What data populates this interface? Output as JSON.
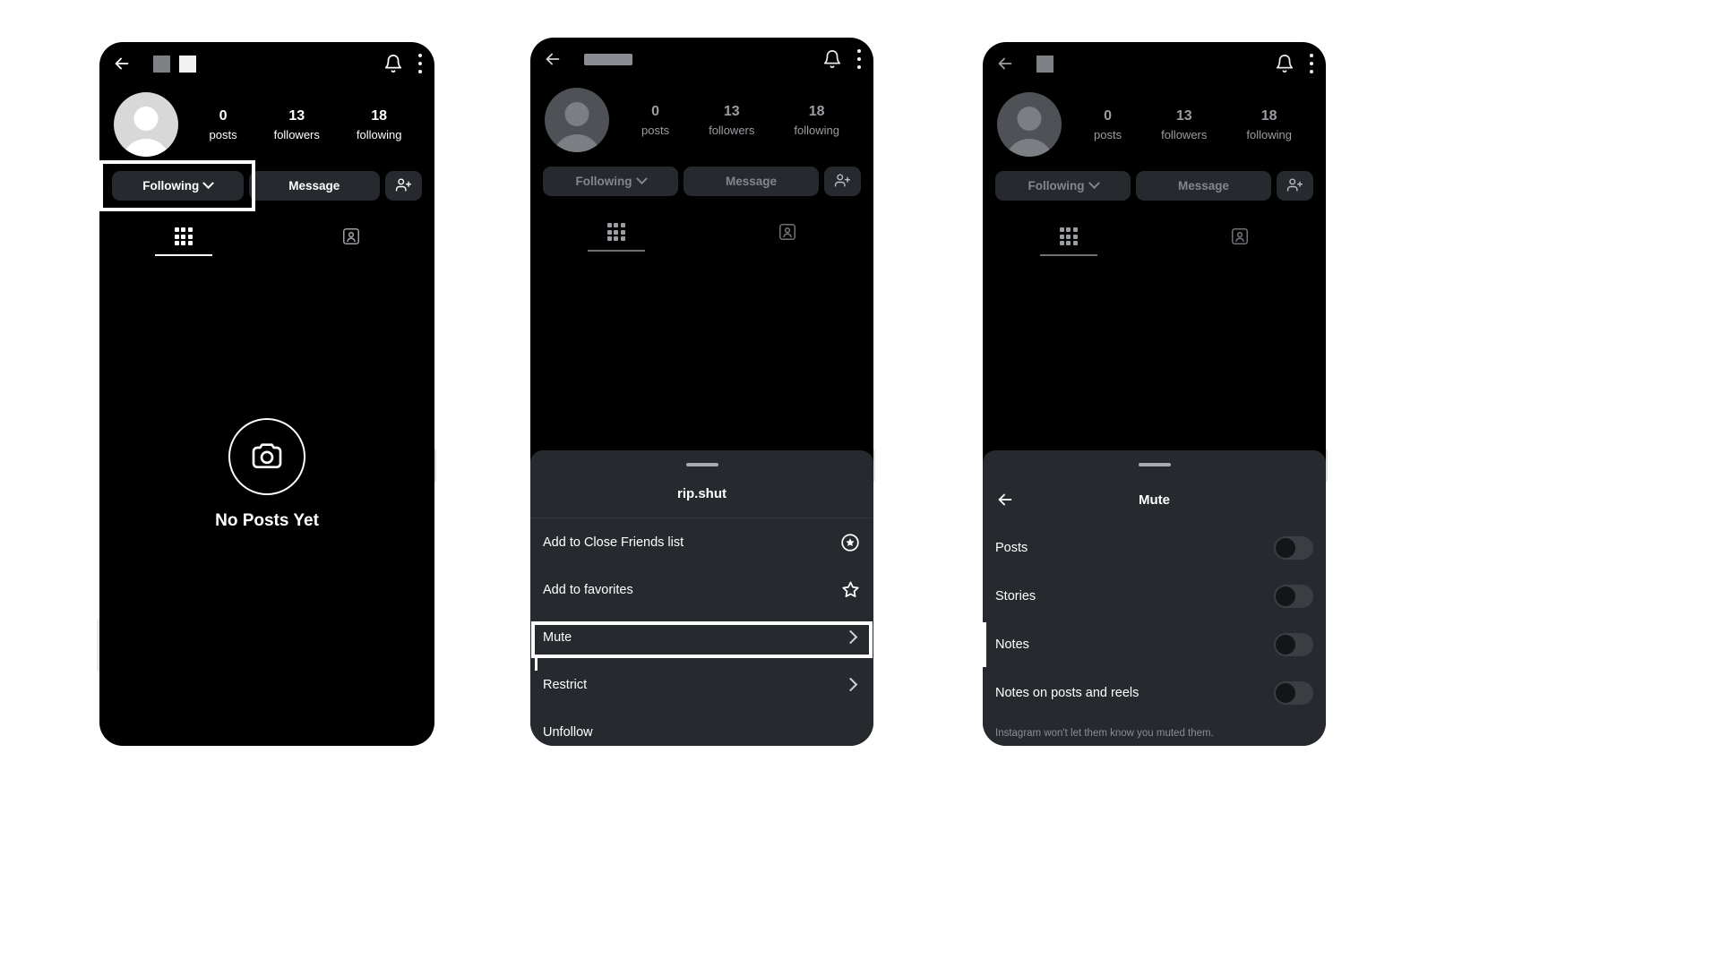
{
  "panels": [
    {
      "id": "profile",
      "topbar": {
        "back": "back-arrow",
        "bell": "notifications-bell",
        "menu": "overflow-menu",
        "username_redacted": true
      },
      "stats": [
        {
          "num": "0",
          "label": "posts"
        },
        {
          "num": "13",
          "label": "followers"
        },
        {
          "num": "18",
          "label": "following"
        }
      ],
      "actions": {
        "following": "Following",
        "message": "Message",
        "adduser": "add-user-icon"
      },
      "tabs": [
        {
          "icon": "grid-icon",
          "active": true
        },
        {
          "icon": "tagged-icon",
          "active": false
        }
      ],
      "empty_state": {
        "icon": "camera-icon",
        "label": "No Posts Yet"
      },
      "highlight": "Following"
    },
    {
      "id": "options-sheet",
      "topbar": {
        "back": "back-arrow",
        "bell": "notifications-bell",
        "menu": "overflow-menu"
      },
      "stats": [
        {
          "num": "0",
          "label": "posts"
        },
        {
          "num": "13",
          "label": "followers"
        },
        {
          "num": "18",
          "label": "following"
        }
      ],
      "actions": {
        "following": "Following",
        "message": "Message",
        "adduser": "add-user-icon"
      },
      "sheet_title": "rip.shut",
      "menu_items": [
        {
          "label": "Add to Close Friends list",
          "icon": "close-friends-star-circle-icon",
          "trailing": "icon"
        },
        {
          "label": "Add to favorites",
          "icon": "favorite-star-icon",
          "trailing": "icon"
        },
        {
          "label": "Mute",
          "icon": "chevron-right-icon",
          "trailing": "chevron",
          "highlighted": true
        },
        {
          "label": "Restrict",
          "icon": "chevron-right-icon",
          "trailing": "chevron"
        },
        {
          "label": "Unfollow",
          "icon": "",
          "trailing": "none"
        }
      ],
      "highlight": "Mute"
    },
    {
      "id": "mute-panel",
      "topbar": {
        "back": "back-arrow",
        "bell": "notifications-bell",
        "menu": "overflow-menu"
      },
      "stats": [
        {
          "num": "0",
          "label": "posts"
        },
        {
          "num": "13",
          "label": "followers"
        },
        {
          "num": "18",
          "label": "following"
        }
      ],
      "actions": {
        "following": "Following",
        "message": "Message",
        "adduser": "add-user-icon"
      },
      "sheet_title": "Mute",
      "back_label": "back-arrow",
      "toggles": [
        {
          "label": "Posts",
          "on": false
        },
        {
          "label": "Stories",
          "on": false
        },
        {
          "label": "Notes",
          "on": false
        },
        {
          "label": "Notes on posts and reels",
          "on": false
        }
      ],
      "footer": "Instagram won't let them know you muted them."
    }
  ],
  "colors": {
    "background": "#ffffff",
    "phone_bg": "#000000",
    "sheet_bg": "#262a2e",
    "button_bg": "#262a2e",
    "text_primary": "#ffffff",
    "text_dim": "#8a8d92",
    "highlight_border": "#ffffff",
    "toggle_track": "#3a3e43",
    "toggle_knob": "#131619"
  }
}
